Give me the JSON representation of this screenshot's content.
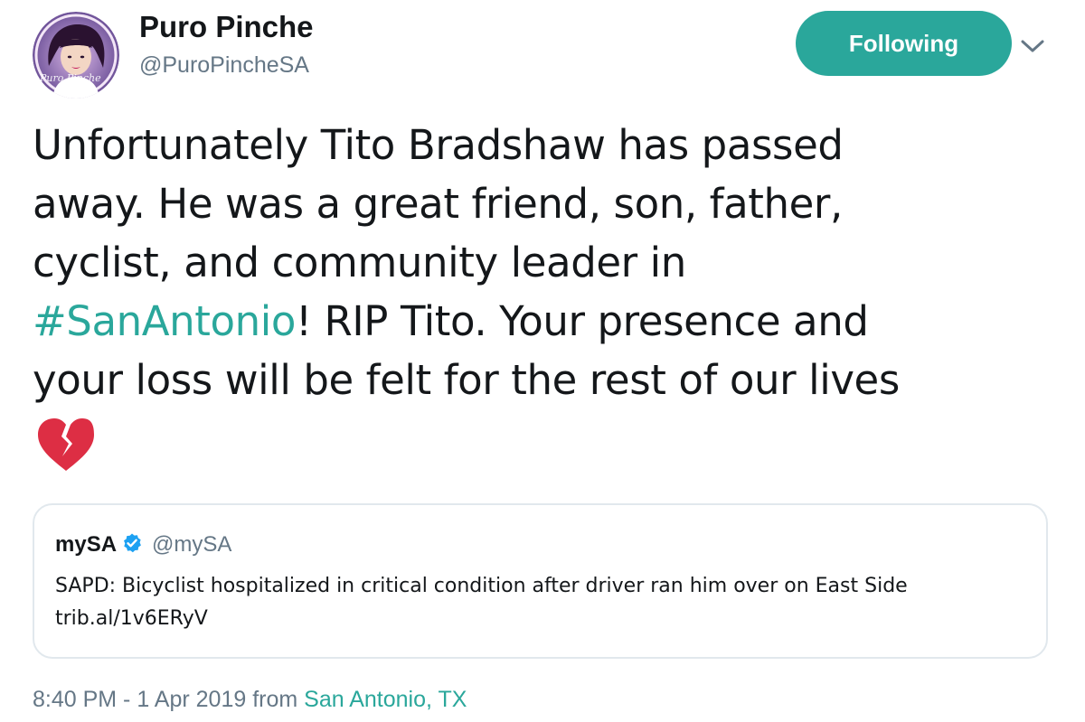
{
  "colors": {
    "accent": "#2aa79b",
    "link": "#1b95e0",
    "secondary": "#657786",
    "border": "#e1e8ed"
  },
  "author": {
    "display_name": "Puro Pinche",
    "handle": "@PuroPincheSA",
    "avatar_text": "Puro Pinche"
  },
  "follow_button": {
    "label": "Following"
  },
  "tweet": {
    "lines": [
      "Unfortunately Tito Bradshaw has passed",
      "away. He was a great friend, son, father,",
      "cyclist, and community leader in"
    ],
    "hashtag": "#SanAntonio",
    "line4_rest": "! RIP Tito. Your presence and",
    "line5": "your loss will be felt for the rest of our lives",
    "emoji": "broken-heart-icon"
  },
  "quote": {
    "name": "mySA",
    "handle": "@mySA",
    "text": "SAPD: Bicyclist hospitalized in critical condition after driver ran him over on East Side",
    "link": "trib.al/1v6ERyV"
  },
  "meta": {
    "timestamp": "8:40 PM - 1 Apr 2019",
    "from_label": "from",
    "location": "San Antonio, TX"
  }
}
